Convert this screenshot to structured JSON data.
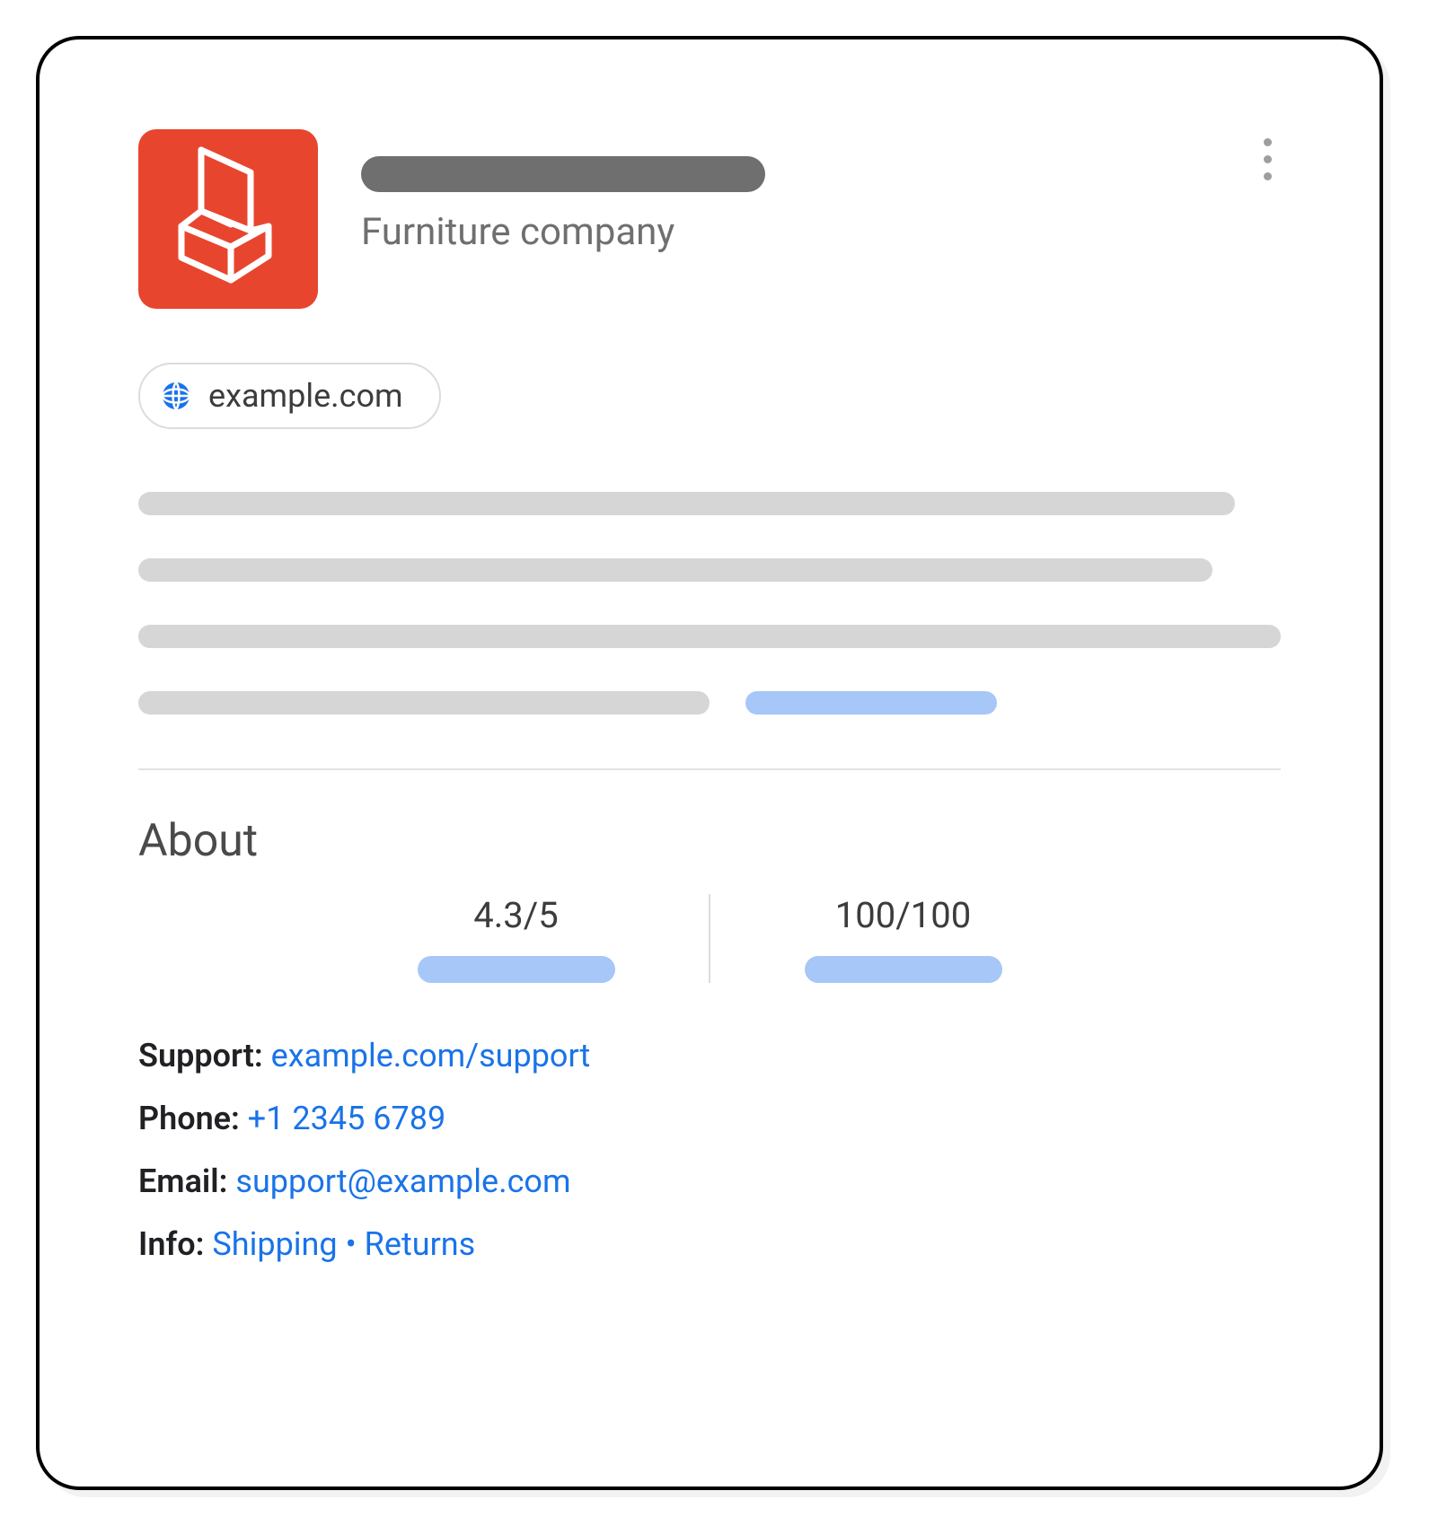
{
  "header": {
    "subtitle": "Furniture company"
  },
  "site": {
    "domain": "example.com"
  },
  "about": {
    "heading": "About",
    "rating": "4.3/5",
    "score": "100/100"
  },
  "contact": {
    "support_label": "Support:",
    "support_link": "example.com/support",
    "phone_label": "Phone:",
    "phone_link": "+1 2345 6789",
    "email_label": "Email:",
    "email_link": "support@example.com",
    "info_label": "Info:",
    "info_shipping": "Shipping",
    "info_sep": "•",
    "info_returns": "Returns"
  }
}
